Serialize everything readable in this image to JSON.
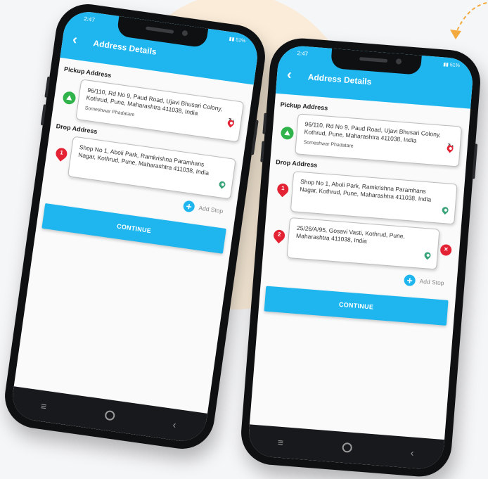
{
  "deco": {
    "blob_color": "#faecd8",
    "arrow_color": "#f4a93c"
  },
  "theme": {
    "primary": "#1fb6ef",
    "pickup_green": "#2fb34a",
    "drop_red": "#e32234",
    "loc_teal": "#3aa37a"
  },
  "left_phone": {
    "status": {
      "time": "2:47",
      "battery": "51%"
    },
    "header": {
      "back_icon": "back-arrow-icon",
      "title": "Address Details"
    },
    "pickup": {
      "label": "Pickup Address",
      "address": "96/110, Rd No 9, Paud Road, Ujavi Bhusari Colony, Kothrud, Pune, Maharashtra 411038, India",
      "name": "Someshwar Phadatare"
    },
    "drop": {
      "label": "Drop Address",
      "stops": [
        {
          "num": "1",
          "address": "Shop No 1, Aboli Park, Ramkrishna Paramhans Nagar, Kothrud, Pune, Maharashtra 411038, India"
        }
      ]
    },
    "add_stop": "Add Stop",
    "continue": "CONTINUE"
  },
  "right_phone": {
    "status": {
      "time": "2:47",
      "battery": "51%"
    },
    "header": {
      "back_icon": "back-arrow-icon",
      "title": "Address Details"
    },
    "pickup": {
      "label": "Pickup Address",
      "address": "96/110, Rd No 9, Paud Road, Ujavi Bhusari Colony, Kothrud, Pune, Maharashtra 411038, India",
      "name": "Someshwar Phadatare"
    },
    "drop": {
      "label": "Drop Address",
      "stops": [
        {
          "num": "1",
          "address": "Shop No 1, Aboli Park, Ramkrishna Paramhans Nagar, Kothrud, Pune, Maharashtra 411038, India"
        },
        {
          "num": "2",
          "address": "25/26/A/95, Gosavi Vasti, Kothrud, Pune, Maharashtra 411038, India"
        }
      ]
    },
    "add_stop": "Add Stop",
    "continue": "CONTINUE"
  }
}
